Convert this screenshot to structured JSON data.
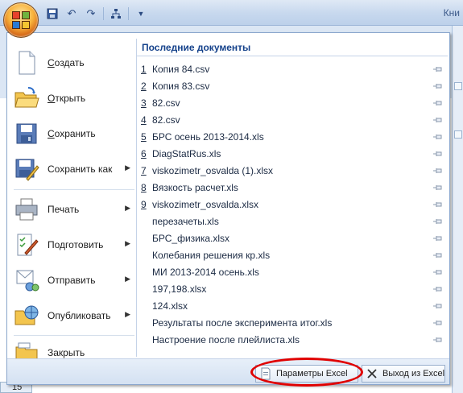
{
  "app": {
    "title_fragment": "Кни",
    "qat_icons": [
      "save-icon",
      "undo-icon",
      "redo-icon",
      "org-chart-icon",
      "customize-qat-icon"
    ]
  },
  "menu": {
    "left_items": [
      {
        "label": "Создать",
        "mnemonic": "С",
        "rest": "оздать",
        "icon": "new-document-icon",
        "has_submenu": false
      },
      {
        "label": "Открыть",
        "mnemonic": "О",
        "rest": "ткрыть",
        "icon": "open-folder-icon",
        "has_submenu": false
      },
      {
        "label": "Сохранить",
        "mnemonic": "С",
        "rest": "охранить",
        "icon": "save-icon",
        "has_submenu": false
      },
      {
        "label": "Сохранить как",
        "mnemonic": "",
        "rest": "Сохранить как",
        "icon": "save-as-icon",
        "has_submenu": true
      },
      {
        "label": "Печать",
        "mnemonic": "",
        "rest": "Печать",
        "icon": "printer-icon",
        "has_submenu": true
      },
      {
        "label": "Подготовить",
        "mnemonic": "",
        "rest": "Подготовить",
        "icon": "prepare-document-icon",
        "has_submenu": true
      },
      {
        "label": "Отправить",
        "mnemonic": "",
        "rest": "Отправить",
        "icon": "send-icon",
        "has_submenu": true
      },
      {
        "label": "Опубликовать",
        "mnemonic": "",
        "rest": "Опубликовать",
        "icon": "publish-icon",
        "has_submenu": true
      },
      {
        "label": "Закрыть",
        "mnemonic": "",
        "rest": "Закрыть",
        "icon": "close-folder-icon",
        "has_submenu": false
      }
    ],
    "recent": {
      "header": "Последние документы",
      "items": [
        {
          "num": "1",
          "name": "Копия 84.csv"
        },
        {
          "num": "2",
          "name": "Копия 83.csv"
        },
        {
          "num": "3",
          "name": "82.csv"
        },
        {
          "num": "4",
          "name": "82.csv"
        },
        {
          "num": "5",
          "name": "БРС осень 2013-2014.xls"
        },
        {
          "num": "6",
          "name": "DiagStatRus.xls"
        },
        {
          "num": "7",
          "name": "viskozimetr_osvalda (1).xlsx"
        },
        {
          "num": "8",
          "name": "Вязкость расчет.xls"
        },
        {
          "num": "9",
          "name": "viskozimetr_osvalda.xlsx"
        },
        {
          "num": "",
          "name": "перезачеты.xls"
        },
        {
          "num": "",
          "name": "БРС_физика.xlsx"
        },
        {
          "num": "",
          "name": "Колебания решения кр.xls"
        },
        {
          "num": "",
          "name": "МИ 2013-2014 осень.xls"
        },
        {
          "num": "",
          "name": "197,198.xlsx"
        },
        {
          "num": "",
          "name": "124.xlsx"
        },
        {
          "num": "",
          "name": "Результаты после эксперимента итог.xls"
        },
        {
          "num": "",
          "name": "Настроение после плейлиста.xls"
        }
      ]
    },
    "bottom": {
      "options_label": "Параметры Excel",
      "exit_label": "Выход из Excel"
    }
  },
  "sheet": {
    "row_number": "15"
  },
  "colors": {
    "accent": "#15428b",
    "highlight_ring": "#e00000"
  }
}
